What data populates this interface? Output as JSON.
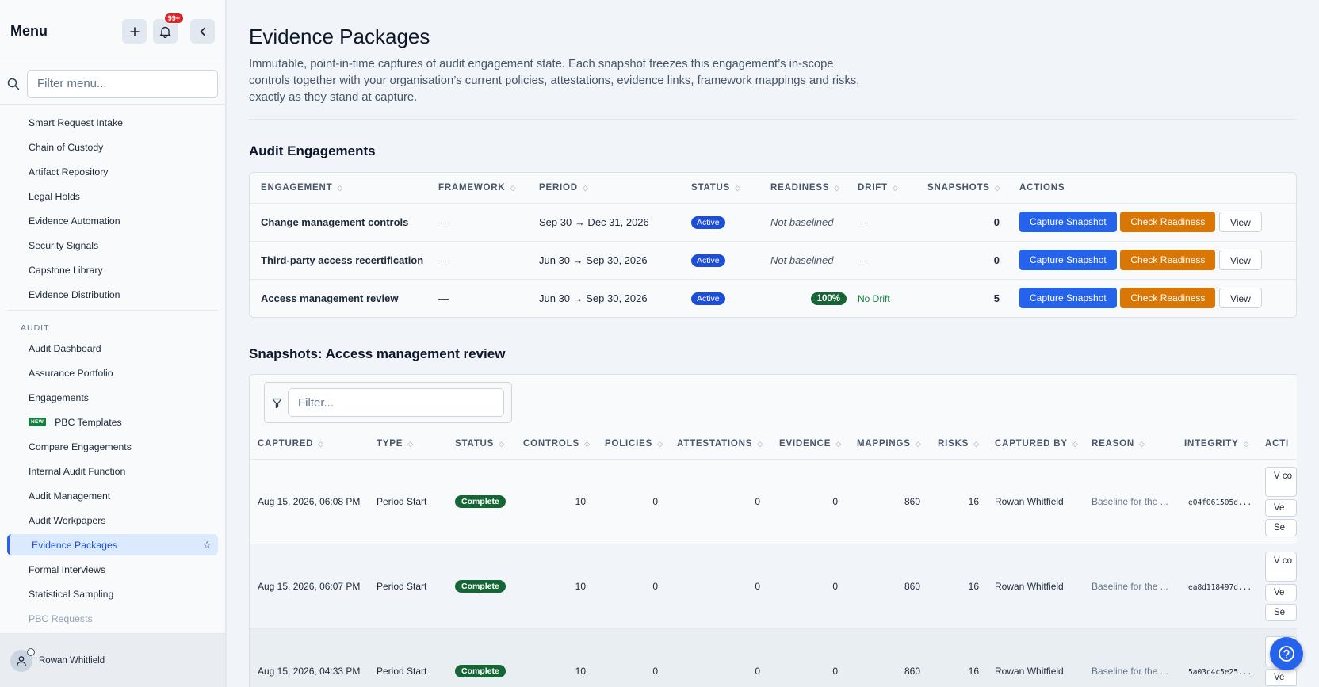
{
  "sidebar": {
    "title": "Menu",
    "notif_count": "99+",
    "search_placeholder": "Filter menu...",
    "items_top": [
      "Smart Request Intake",
      "Chain of Custody",
      "Artifact Repository",
      "Legal Holds",
      "Evidence Automation",
      "Security Signals",
      "Capstone Library",
      "Evidence Distribution"
    ],
    "section_audit": "AUDIT",
    "audit_items": {
      "audit_dashboard": "Audit Dashboard",
      "assurance_portfolio": "Assurance Portfolio",
      "engagements": "Engagements",
      "pbc_templates": "PBC Templates",
      "pbc_new_badge": "NEW",
      "compare_engagements": "Compare Engagements",
      "internal_audit_function": "Internal Audit Function",
      "audit_management": "Audit Management",
      "audit_workpapers": "Audit Workpapers",
      "evidence_packages": "Evidence Packages",
      "formal_interviews": "Formal Interviews",
      "statistical_sampling": "Statistical Sampling",
      "pbc_requests": "PBC Requests"
    },
    "user_name": "Rowan Whitfield"
  },
  "page": {
    "title": "Evidence Packages",
    "description": "Immutable, point-in-time captures of audit engagement state. Each snapshot freezes this engagement’s in-scope controls together with your organisation’s current policies, attestations, evidence links, framework mappings and risks, exactly as they stand at capture."
  },
  "engagements": {
    "section_title": "Audit Engagements",
    "columns": [
      "ENGAGEMENT",
      "FRAMEWORK",
      "PERIOD",
      "STATUS",
      "READINESS",
      "DRIFT",
      "SNAPSHOTS",
      "ACTIONS"
    ],
    "btn_capture": "Capture Snapshot",
    "btn_check": "Check Readiness",
    "btn_view": "View",
    "rows": [
      {
        "name": "Change management controls",
        "framework": "—",
        "period": "Sep 30 → Dec 31, 2026",
        "status": "Active",
        "readiness": "Not baselined",
        "drift": "—",
        "snapshots": "0"
      },
      {
        "name": "Third-party access recertification",
        "framework": "—",
        "period": "Jun 30 → Sep 30, 2026",
        "status": "Active",
        "readiness": "Not baselined",
        "drift": "—",
        "snapshots": "0"
      },
      {
        "name": "Access management review",
        "framework": "—",
        "period": "Jun 30 → Sep 30, 2026",
        "status": "Active",
        "readiness": "100%",
        "drift": "No Drift",
        "snapshots": "5"
      }
    ]
  },
  "snapshots": {
    "section_title": "Snapshots: Access management review",
    "filter_placeholder": "Filter...",
    "columns": [
      "CAPTURED",
      "TYPE",
      "STATUS",
      "CONTROLS",
      "POLICIES",
      "ATTESTATIONS",
      "EVIDENCE",
      "MAPPINGS",
      "RISKS",
      "CAPTURED BY",
      "REASON",
      "INTEGRITY",
      "ACTI"
    ],
    "action_labels": [
      "V co",
      "Ve",
      "Se"
    ],
    "rows": [
      {
        "captured": "Aug 15, 2026, 06:08 PM",
        "type": "Period Start",
        "status": "Complete",
        "controls": "10",
        "policies": "0",
        "attestations": "0",
        "evidence": "0",
        "mappings": "860",
        "risks": "16",
        "captured_by": "Rowan Whitfield",
        "reason": "Baseline for the ...",
        "integrity": "e04f061505d..."
      },
      {
        "captured": "Aug 15, 2026, 06:07 PM",
        "type": "Period Start",
        "status": "Complete",
        "controls": "10",
        "policies": "0",
        "attestations": "0",
        "evidence": "0",
        "mappings": "860",
        "risks": "16",
        "captured_by": "Rowan Whitfield",
        "reason": "Baseline for the ...",
        "integrity": "ea8d118497d..."
      },
      {
        "captured": "Aug 15, 2026, 04:33 PM",
        "type": "Period Start",
        "status": "Complete",
        "controls": "10",
        "policies": "0",
        "attestations": "0",
        "evidence": "0",
        "mappings": "860",
        "risks": "16",
        "captured_by": "Rowan Whitfield",
        "reason": "Baseline for the ...",
        "integrity": "5a03c4c5e25..."
      }
    ]
  }
}
